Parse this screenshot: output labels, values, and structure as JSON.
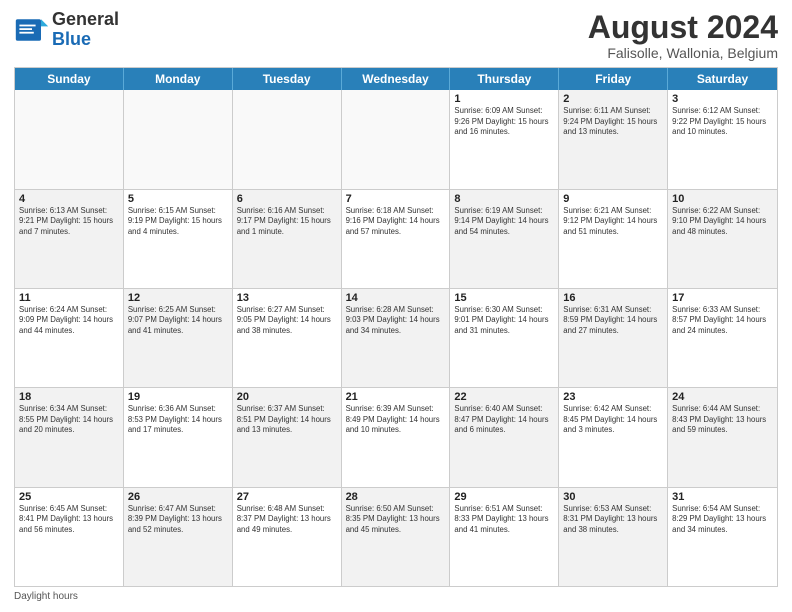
{
  "header": {
    "logo_general": "General",
    "logo_blue": "Blue",
    "main_title": "August 2024",
    "sub_title": "Falisolle, Wallonia, Belgium"
  },
  "weekdays": [
    "Sunday",
    "Monday",
    "Tuesday",
    "Wednesday",
    "Thursday",
    "Friday",
    "Saturday"
  ],
  "weeks": [
    [
      {
        "day": "",
        "info": "",
        "shade": "empty"
      },
      {
        "day": "",
        "info": "",
        "shade": "empty"
      },
      {
        "day": "",
        "info": "",
        "shade": "empty"
      },
      {
        "day": "",
        "info": "",
        "shade": "empty"
      },
      {
        "day": "1",
        "info": "Sunrise: 6:09 AM\nSunset: 9:26 PM\nDaylight: 15 hours and 16 minutes.",
        "shade": ""
      },
      {
        "day": "2",
        "info": "Sunrise: 6:11 AM\nSunset: 9:24 PM\nDaylight: 15 hours and 13 minutes.",
        "shade": "shaded"
      },
      {
        "day": "3",
        "info": "Sunrise: 6:12 AM\nSunset: 9:22 PM\nDaylight: 15 hours and 10 minutes.",
        "shade": ""
      }
    ],
    [
      {
        "day": "4",
        "info": "Sunrise: 6:13 AM\nSunset: 9:21 PM\nDaylight: 15 hours and 7 minutes.",
        "shade": "shaded"
      },
      {
        "day": "5",
        "info": "Sunrise: 6:15 AM\nSunset: 9:19 PM\nDaylight: 15 hours and 4 minutes.",
        "shade": ""
      },
      {
        "day": "6",
        "info": "Sunrise: 6:16 AM\nSunset: 9:17 PM\nDaylight: 15 hours and 1 minute.",
        "shade": "shaded"
      },
      {
        "day": "7",
        "info": "Sunrise: 6:18 AM\nSunset: 9:16 PM\nDaylight: 14 hours and 57 minutes.",
        "shade": ""
      },
      {
        "day": "8",
        "info": "Sunrise: 6:19 AM\nSunset: 9:14 PM\nDaylight: 14 hours and 54 minutes.",
        "shade": "shaded"
      },
      {
        "day": "9",
        "info": "Sunrise: 6:21 AM\nSunset: 9:12 PM\nDaylight: 14 hours and 51 minutes.",
        "shade": ""
      },
      {
        "day": "10",
        "info": "Sunrise: 6:22 AM\nSunset: 9:10 PM\nDaylight: 14 hours and 48 minutes.",
        "shade": "shaded"
      }
    ],
    [
      {
        "day": "11",
        "info": "Sunrise: 6:24 AM\nSunset: 9:09 PM\nDaylight: 14 hours and 44 minutes.",
        "shade": ""
      },
      {
        "day": "12",
        "info": "Sunrise: 6:25 AM\nSunset: 9:07 PM\nDaylight: 14 hours and 41 minutes.",
        "shade": "shaded"
      },
      {
        "day": "13",
        "info": "Sunrise: 6:27 AM\nSunset: 9:05 PM\nDaylight: 14 hours and 38 minutes.",
        "shade": ""
      },
      {
        "day": "14",
        "info": "Sunrise: 6:28 AM\nSunset: 9:03 PM\nDaylight: 14 hours and 34 minutes.",
        "shade": "shaded"
      },
      {
        "day": "15",
        "info": "Sunrise: 6:30 AM\nSunset: 9:01 PM\nDaylight: 14 hours and 31 minutes.",
        "shade": ""
      },
      {
        "day": "16",
        "info": "Sunrise: 6:31 AM\nSunset: 8:59 PM\nDaylight: 14 hours and 27 minutes.",
        "shade": "shaded"
      },
      {
        "day": "17",
        "info": "Sunrise: 6:33 AM\nSunset: 8:57 PM\nDaylight: 14 hours and 24 minutes.",
        "shade": ""
      }
    ],
    [
      {
        "day": "18",
        "info": "Sunrise: 6:34 AM\nSunset: 8:55 PM\nDaylight: 14 hours and 20 minutes.",
        "shade": "shaded"
      },
      {
        "day": "19",
        "info": "Sunrise: 6:36 AM\nSunset: 8:53 PM\nDaylight: 14 hours and 17 minutes.",
        "shade": ""
      },
      {
        "day": "20",
        "info": "Sunrise: 6:37 AM\nSunset: 8:51 PM\nDaylight: 14 hours and 13 minutes.",
        "shade": "shaded"
      },
      {
        "day": "21",
        "info": "Sunrise: 6:39 AM\nSunset: 8:49 PM\nDaylight: 14 hours and 10 minutes.",
        "shade": ""
      },
      {
        "day": "22",
        "info": "Sunrise: 6:40 AM\nSunset: 8:47 PM\nDaylight: 14 hours and 6 minutes.",
        "shade": "shaded"
      },
      {
        "day": "23",
        "info": "Sunrise: 6:42 AM\nSunset: 8:45 PM\nDaylight: 14 hours and 3 minutes.",
        "shade": ""
      },
      {
        "day": "24",
        "info": "Sunrise: 6:44 AM\nSunset: 8:43 PM\nDaylight: 13 hours and 59 minutes.",
        "shade": "shaded"
      }
    ],
    [
      {
        "day": "25",
        "info": "Sunrise: 6:45 AM\nSunset: 8:41 PM\nDaylight: 13 hours and 56 minutes.",
        "shade": ""
      },
      {
        "day": "26",
        "info": "Sunrise: 6:47 AM\nSunset: 8:39 PM\nDaylight: 13 hours and 52 minutes.",
        "shade": "shaded"
      },
      {
        "day": "27",
        "info": "Sunrise: 6:48 AM\nSunset: 8:37 PM\nDaylight: 13 hours and 49 minutes.",
        "shade": ""
      },
      {
        "day": "28",
        "info": "Sunrise: 6:50 AM\nSunset: 8:35 PM\nDaylight: 13 hours and 45 minutes.",
        "shade": "shaded"
      },
      {
        "day": "29",
        "info": "Sunrise: 6:51 AM\nSunset: 8:33 PM\nDaylight: 13 hours and 41 minutes.",
        "shade": ""
      },
      {
        "day": "30",
        "info": "Sunrise: 6:53 AM\nSunset: 8:31 PM\nDaylight: 13 hours and 38 minutes.",
        "shade": "shaded"
      },
      {
        "day": "31",
        "info": "Sunrise: 6:54 AM\nSunset: 8:29 PM\nDaylight: 13 hours and 34 minutes.",
        "shade": ""
      }
    ]
  ],
  "footer": {
    "note": "Daylight hours"
  }
}
